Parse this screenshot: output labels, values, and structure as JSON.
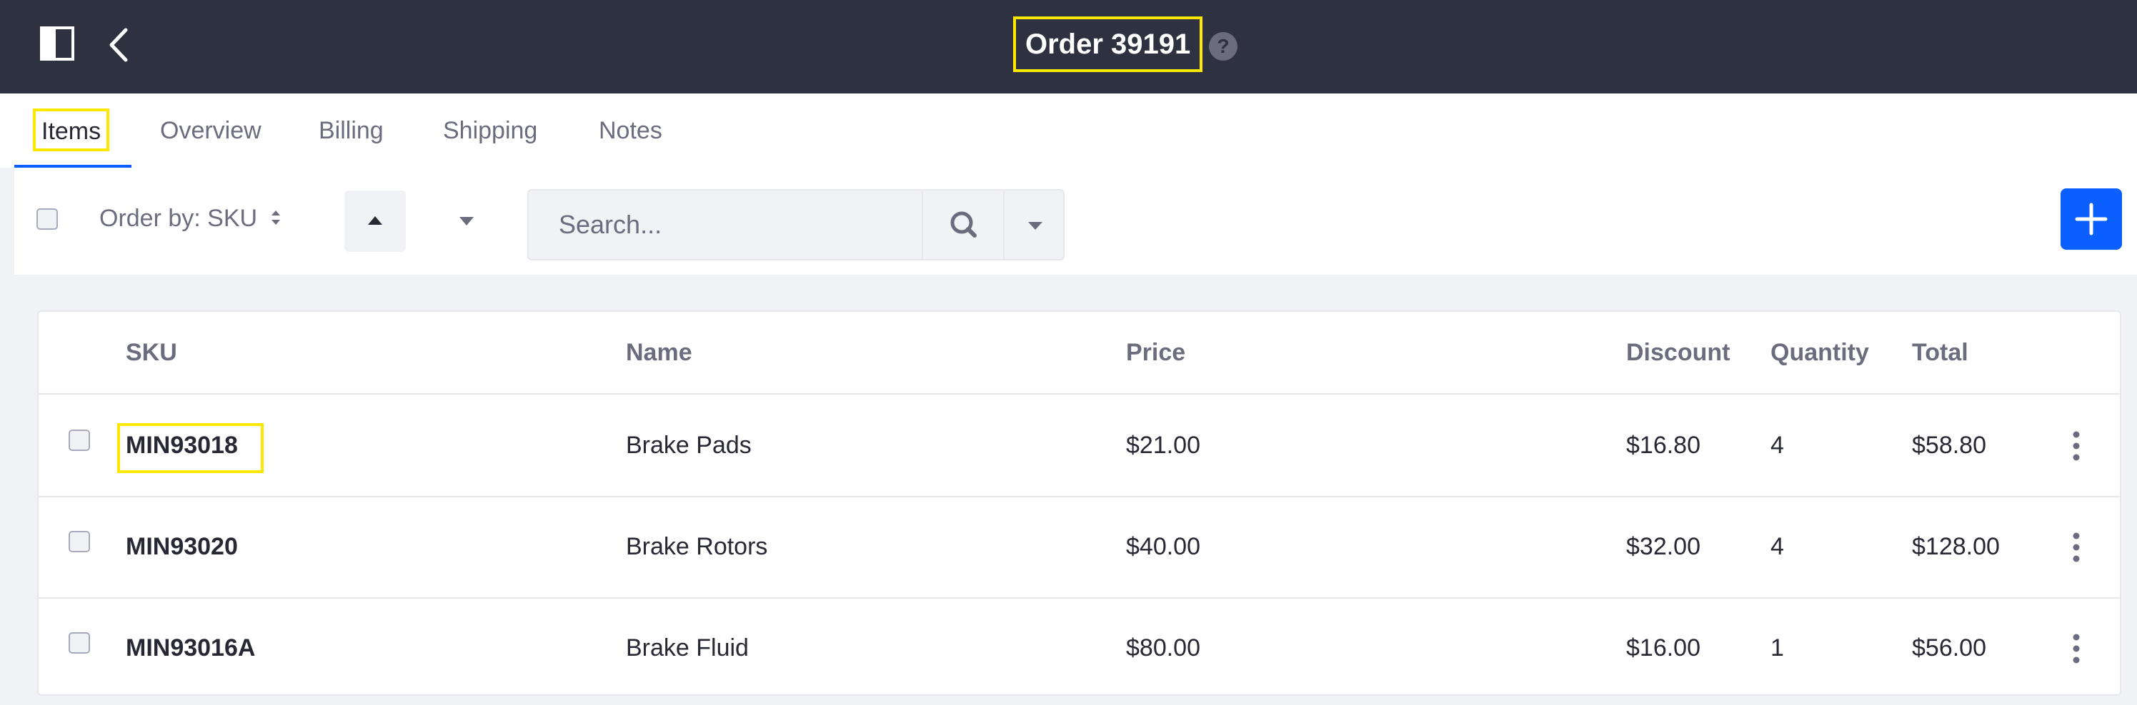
{
  "header": {
    "title": "Order 39191",
    "help_glyph": "?",
    "icons": [
      "sidebar-toggle-icon",
      "back-arrow-icon",
      "help-icon"
    ],
    "background_color": "#2e313f"
  },
  "tabs": [
    {
      "label": "Items",
      "active": true
    },
    {
      "label": "Overview"
    },
    {
      "label": "Billing"
    },
    {
      "label": "Shipping"
    },
    {
      "label": "Notes"
    }
  ],
  "toolbar": {
    "order_by_label": "Order by: SKU",
    "search_placeholder": "Search...",
    "icons": [
      "sort-ascending-icon",
      "sort-descending-icon",
      "search-icon",
      "chevron-down-icon",
      "plus-icon"
    ],
    "accent_color": "#0b5fff"
  },
  "table": {
    "columns": [
      "SKU",
      "Name",
      "Price",
      "Discount",
      "Quantity",
      "Total"
    ],
    "rows": [
      {
        "sku": "MIN93018",
        "name": "Brake Pads",
        "price": "$21.00",
        "discount": "$16.80",
        "quantity": "4",
        "total": "$58.80"
      },
      {
        "sku": "MIN93020",
        "name": "Brake Rotors",
        "price": "$40.00",
        "discount": "$32.00",
        "quantity": "4",
        "total": "$128.00"
      },
      {
        "sku": "MIN93016A",
        "name": "Brake Fluid",
        "price": "$80.00",
        "discount": "$16.00",
        "quantity": "1",
        "total": "$56.00"
      }
    ]
  },
  "highlight_color": "#ffe800"
}
